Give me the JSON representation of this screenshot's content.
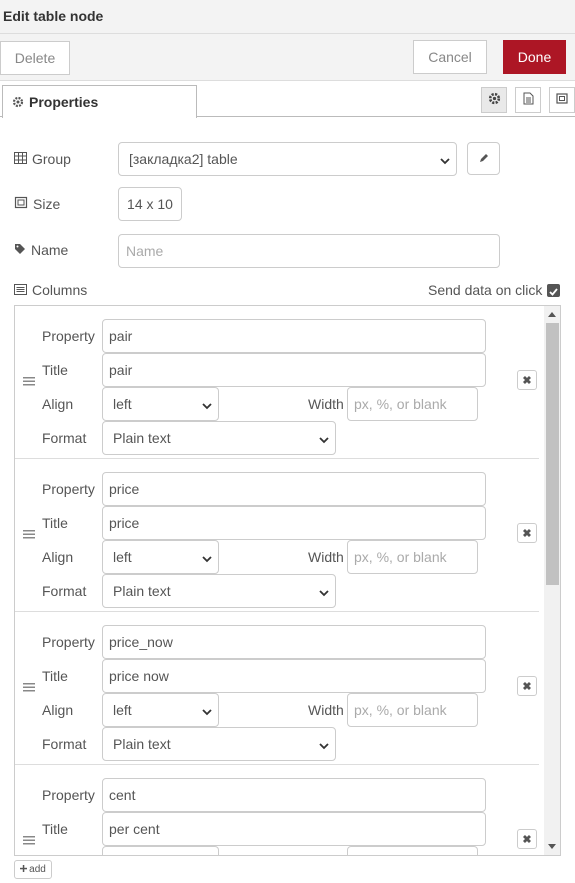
{
  "header": {
    "title": "Edit table node"
  },
  "actions": {
    "delete_label": "Delete",
    "cancel_label": "Cancel",
    "done_label": "Done"
  },
  "tabs": {
    "properties_label": "Properties"
  },
  "form": {
    "group_label": "Group",
    "group_value": "[закладка2] table",
    "size_label": "Size",
    "size_value": "14 x 10",
    "name_label": "Name",
    "name_placeholder": "Name",
    "columns_label": "Columns",
    "send_data_label": "Send data on click",
    "send_data_checked": true
  },
  "column_labels": {
    "property": "Property",
    "title": "Title",
    "align": "Align",
    "width": "Width",
    "format": "Format"
  },
  "columns": [
    {
      "property": "pair",
      "title": "pair",
      "align": "left",
      "width_placeholder": "px, %, or blank",
      "format": "Plain text"
    },
    {
      "property": "price",
      "title": "price",
      "align": "left",
      "width_placeholder": "px, %, or blank",
      "format": "Plain text"
    },
    {
      "property": "price_now",
      "title": "price now",
      "align": "left",
      "width_placeholder": "px, %, or blank",
      "format": "Plain text"
    },
    {
      "property": "cent",
      "title": "per cent",
      "align": "",
      "width_placeholder": "",
      "format": ""
    }
  ],
  "footer": {
    "add_label": "add"
  },
  "colors": {
    "done_bg": "#ad1625",
    "border": "#cccccc"
  }
}
